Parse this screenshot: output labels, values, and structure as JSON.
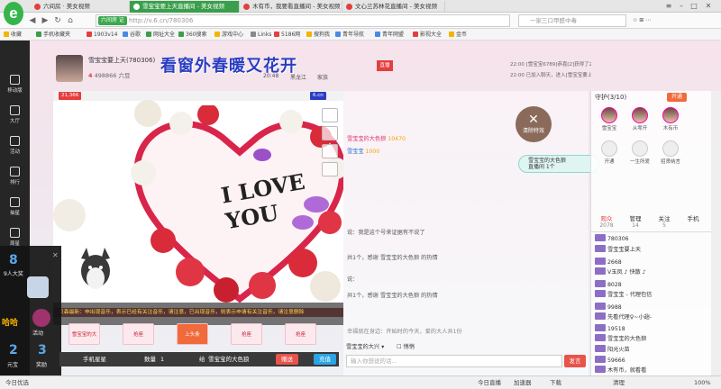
{
  "browser": {
    "tabs": [
      {
        "label": "六间房 · 美女视频",
        "active": false
      },
      {
        "label": "雪宝宝要上天直播间 - 美女视频",
        "active": true
      },
      {
        "label": "木有币，我要看直播间 - 美女视频",
        "active": false
      },
      {
        "label": "文心兰苏林花直播间 - 美女视频",
        "active": false
      }
    ],
    "url_tag": "六间房 证",
    "url": "http://v.6.cn/780306",
    "search_placeholder": "一家三口甲醛中毒",
    "toolbar_right": [
      "扩展",
      "网银",
      "翻译",
      "截图",
      "游戏",
      "登录管家"
    ],
    "bookmarks": [
      "收藏",
      "手机收藏夹",
      "1903v14",
      "谷歌",
      "网址大全",
      "360搜索",
      "游戏中心",
      "Links",
      "5186网",
      "搜狗我",
      "青年导航",
      "青年网盟",
      "影视大全",
      "金币"
    ]
  },
  "leftnav": {
    "items": [
      "移动版",
      "大厅",
      "活动",
      "排行",
      "抽星",
      "周星"
    ],
    "overlay_numbers": [
      "8",
      "3",
      "2",
      "3"
    ],
    "overlay_labels": [
      "9人大奖",
      "哈哈",
      "活动",
      "元宝",
      "发福",
      "奖励"
    ]
  },
  "room": {
    "host_name": "雪宝宝要上天(780306)",
    "host_level": "4",
    "host_fans": "498866 六豆",
    "banner": "看窗外春暖又花开",
    "meta": [
      "20:48",
      "黑龙江",
      "家族"
    ],
    "badge": "直播",
    "viewers": "21,366",
    "brand": "6.cn"
  },
  "video": {
    "love_text": "I LOVE YOU",
    "notice": "贝森最新：申出现音乐，表示已经有关注音乐，请注意，已出现音乐，则表示申请有关注音乐，请注意删除",
    "bottom_buttons": [
      "雪宝宝的大",
      "抢座",
      "上头条",
      "抢座",
      "抢座"
    ]
  },
  "send": {
    "label": "手机星星",
    "quantity_label": "数量",
    "quantity": "1",
    "to_label": "给",
    "to": "雪宝宝的大色狼",
    "gift_btn": "赠送",
    "send_btn": "充值"
  },
  "chat": {
    "top_lines": [
      "22:00 [雪宝宝6789]恭喜[2]获得了2张VIP卡，得到了一个专属勋章",
      "22:00 已加入聊天，进入[雪宝宝要上天]"
    ],
    "close_badge_label": "清除特效",
    "gift_bubble_1": "雪宝宝的大色狼",
    "gift_bubble_2": "直播间 1个",
    "messages": [
      {
        "time": "",
        "text": "雪宝宝的大色狼",
        "amount": "10470"
      },
      {
        "time": "",
        "text": "雪宝宝",
        "amount": "1000"
      },
      {
        "time": "",
        "text": "说：我是这个号来证据有不说了",
        "amount": ""
      },
      {
        "time": "",
        "text": "共1个，感谢 雪宝宝的大色狼 的热情",
        "amount": ""
      },
      {
        "time": "",
        "text": "说：",
        "amount": ""
      },
      {
        "time": "",
        "text": "共1个，感谢 雪宝宝的大色狼 的热情",
        "amount": ""
      }
    ],
    "system_msg": "幸福就在身边：开始时的今天，爱的大人共1份",
    "to_label": "雪宝宝的大兴",
    "checkbox_label": "悄悄",
    "input_placeholder": "输入你想说的话...",
    "send_btn": "发言"
  },
  "right": {
    "guard_title": "守护(3/10)",
    "open_btn": "开通",
    "guards": [
      "雪宝宝",
      "从零开",
      "木有币"
    ],
    "guards2": [
      "开通",
      "一生所爱",
      "招贤纳言"
    ],
    "tabs": [
      {
        "label": "观众",
        "count": "2078"
      },
      {
        "label": "管理",
        "count": "14"
      },
      {
        "label": "关注",
        "count": "5"
      },
      {
        "label": "手机",
        "count": ""
      }
    ],
    "users": [
      "780306",
      "雪宝宝要上天",
      "2668",
      "V玉凤 ♪ 快散 ♪",
      "8028",
      "雪宝宝 - 代理包信",
      "9988",
      "先看代理♀~小翅-",
      "19518",
      "雪宝宝的大色狼",
      "阳光火苗",
      "59666",
      "木有币，就看看"
    ]
  },
  "status": {
    "items": [
      "今日优选",
      "今日直播",
      "加速器",
      "下载",
      "清理",
      "100%"
    ]
  },
  "colors": {
    "accent_green": "#3a9f4b",
    "brand_blue": "#2b3dc2",
    "alert_red": "#e8534a"
  }
}
